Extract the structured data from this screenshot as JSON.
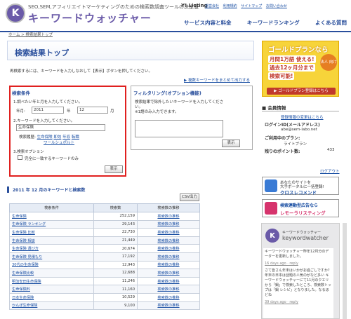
{
  "header": {
    "logo_letter": "K",
    "tagline": "SEO,SEM,アフィリエイトマーケティングのための検索数調査ツールの決定版",
    "logo_text": "キーワードウォッチャー",
    "listing_mark": "Y! Listing",
    "top_links": [
      "運営会社",
      "利用規約",
      "サイトマップ",
      "お問い合わせ"
    ],
    "nav": [
      "サービス内容と料金",
      "キーワードランキング",
      "よくある質問"
    ]
  },
  "breadcrumb": "ホーム > 検索結果トップ",
  "page_title": "検索結果トップ",
  "intro_text": "再検索するには、キーワードを入力しなおして【表示】ボタンを押してください。",
  "bulk_link": "▶ 複数キーワードをまとめて出力する",
  "search_conditions": {
    "title": "検索条件",
    "step1": "1.調べたい年と月を入力してください。",
    "year_label": "年月:",
    "year_value": "2011",
    "year_suffix": "年",
    "month_value": "12",
    "month_suffix": "月",
    "step2": "2.キーワードを入力してください。",
    "keyword_value": "生命保険",
    "history_label": "検索履歴:",
    "history_items": [
      "生命保険",
      "即効",
      "年収",
      "転職"
    ],
    "history_item_2": "ワールシュポルト",
    "step3": "3.検索オプション",
    "exact_match_label": "完全に一致するキーワードのみ",
    "submit_label": "表示"
  },
  "filter": {
    "title": "フィルタリング(オプション機能)",
    "desc1": "検索結果で除外したいキーワードを入力してくださ",
    "desc2": "い。",
    "desc3": "※1語のみ入力できます。",
    "submit_label": "表示"
  },
  "results": {
    "title": "2011 年 12 月のキーワードと検索数",
    "csv_label": "CSV出力",
    "columns": [
      "検索条件",
      "検索数",
      "検索数の推移"
    ],
    "rows": [
      [
        "生命保険",
        "252,159",
        "検索数の推移"
      ],
      [
        "生命保険 ランキング",
        "29,143",
        "検索数の推移"
      ],
      [
        "生命保険 比較",
        "22,730",
        "検索数の推移"
      ],
      [
        "生命保険 相談",
        "21,449",
        "検索数の推移"
      ],
      [
        "生命保険 選び方",
        "20,674",
        "検索数の推移"
      ],
      [
        "生命保険 見積もり",
        "17,192",
        "検索数の推移"
      ],
      [
        "30代の生命保険",
        "12,943",
        "検索数の推移"
      ],
      [
        "生命保険比較",
        "12,688",
        "検索数の推移"
      ],
      [
        "明治安田生命保険",
        "11,246",
        "検索数の推移"
      ],
      [
        "生命保険料",
        "11,160",
        "検索数の推移"
      ],
      [
        "日本生命保険",
        "10,529",
        "検索数の推移"
      ],
      [
        "かんぽ生命保険",
        "9,100",
        "検索数の推移"
      ]
    ]
  },
  "sidebar": {
    "ad": {
      "title": "ゴールドプランなら",
      "line1": "月間1万語 使える!",
      "line2": "過去12ヶ月分まで",
      "line3": "検索可能!",
      "badge": "法人 向け",
      "button": "▶ ゴールドプラン登録はこちら"
    },
    "member": {
      "title": "会員情報",
      "change_link": "登録情報の変更はこちら",
      "login_label": "ログインID(メールアドレス)",
      "login_value": "abe@sem-labo.net",
      "plan_label": "ご利用中のプラン:",
      "plan_value": "ライトプラン",
      "points_label": "残りのポイント数:",
      "points_value": "433",
      "logout": "ログアウト"
    },
    "banner1": {
      "line1": "あなたのサイトを",
      "line2": "大手ポータルに一括登録!",
      "line3": "クロスレコメンド"
    },
    "banner2": {
      "line1": "検索連動型広告なら",
      "line2": "レモーラリスティング"
    },
    "twitter": {
      "account_label": "キーワードウォッチャー",
      "handle": "keywordwatcher",
      "tweet1": "キーワードウォッチャー昨年12月分のデーターを更新しました。",
      "time1": "16 days ago · reply",
      "tweet2": "さて皆さん年末はいかがお過ごしですか? 年末の日本は話題の人気のがなど多い キーワードウォッチャーにて11月のクエリから「鍋」で検索したところ、検索数トップは「鍋 レシピ」となりました。なるほどね",
      "time2": "39 days ago · reply"
    }
  },
  "colors": {
    "brand": "#6a5aa8",
    "nav": "#2a4f9c",
    "highlight": "#e0201f",
    "ad_bg": "#f7d43a"
  }
}
